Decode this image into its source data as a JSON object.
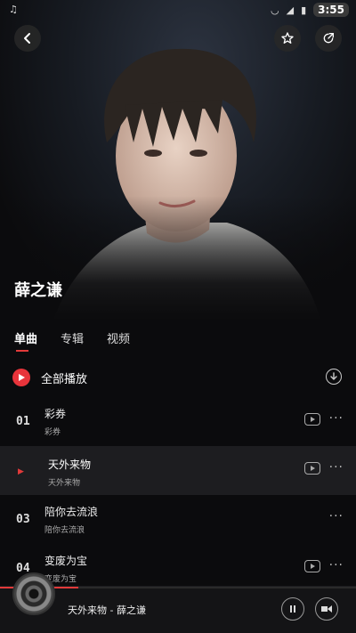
{
  "status_bar": {
    "time": "3:55"
  },
  "artist": {
    "name": "薛之谦"
  },
  "tabs": [
    {
      "label": "单曲",
      "active": true
    },
    {
      "label": "专辑",
      "active": false
    },
    {
      "label": "视频",
      "active": false
    }
  ],
  "play_all": {
    "label": "全部播放"
  },
  "songs": [
    {
      "index": "01",
      "title": "彩券",
      "subtitle": "彩券",
      "has_mv": true,
      "current": false
    },
    {
      "index": "",
      "title": "天外来物",
      "subtitle": "天外来物",
      "has_mv": true,
      "current": true
    },
    {
      "index": "03",
      "title": "陪你去流浪",
      "subtitle": "陪你去流浪",
      "has_mv": false,
      "current": false
    },
    {
      "index": "04",
      "title": "变废为宝",
      "subtitle": "变废为宝",
      "has_mv": true,
      "current": false
    }
  ],
  "player": {
    "now_playing": "天外来物 - 薛之谦",
    "progress_fraction": 0.22
  },
  "colors": {
    "accent": "#e23a3a",
    "background": "#0b0b0d"
  }
}
